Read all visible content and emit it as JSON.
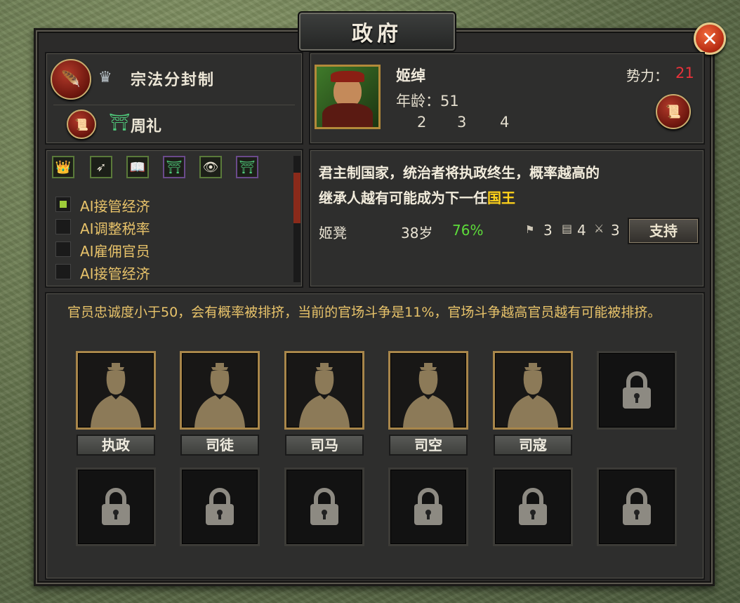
{
  "title": "政府",
  "policy": {
    "primary": "宗法分封制",
    "secondary": "周礼"
  },
  "ruler": {
    "name": "姬绰",
    "age_label": "年龄：51",
    "stats": [
      "2",
      "3",
      "4"
    ],
    "power_label": "势力：",
    "power_value": "21"
  },
  "description": {
    "line1": "君主制国家，统治者将执政终生，概率越高的",
    "line2_prefix": "继承人越有可能成为下一任",
    "line2_highlight": "国王"
  },
  "heir": {
    "name": "姬凳",
    "age": "38岁",
    "probability": "76%",
    "stat1": "3",
    "stat2": "4",
    "stat3": "3",
    "support_label": "支持"
  },
  "ai_options": [
    {
      "label": "AI接管经济",
      "checked": true
    },
    {
      "label": "AI调整税率",
      "checked": false
    },
    {
      "label": "AI雇佣官员",
      "checked": false
    },
    {
      "label": "AI接管经济",
      "checked": false
    }
  ],
  "notice": "官员忠诚度小于50，会有概率被排挤，当前的官场斗争是11%，官场斗争越高官员越有可能被排挤。",
  "offices": [
    {
      "label": "执政",
      "locked": false
    },
    {
      "label": "司徒",
      "locked": false
    },
    {
      "label": "司马",
      "locked": false
    },
    {
      "label": "司空",
      "locked": false
    },
    {
      "label": "司寇",
      "locked": false
    }
  ],
  "colors": {
    "accent_gold": "#e8c36a",
    "highlight_yellow": "#ffd21a",
    "power_red": "#e8323a",
    "prob_green": "#5ddc3a"
  }
}
